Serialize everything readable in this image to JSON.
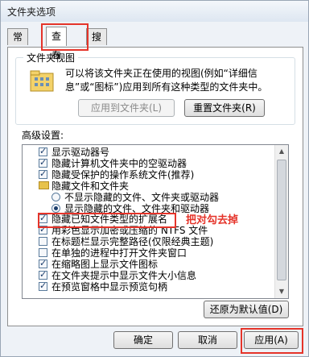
{
  "window": {
    "title": "文件夹选项"
  },
  "tabs": [
    {
      "label": "常规",
      "active": false
    },
    {
      "label": "查看",
      "active": true
    },
    {
      "label": "搜索",
      "active": false
    }
  ],
  "folder_views": {
    "group_label": "文件夹视图",
    "description": "可以将该文件夹正在使用的视图(例如“详细信息”或“图标”)应用到所有这种类型的文件夹中。",
    "apply_button": "应用到文件夹(L)",
    "reset_button": "重置文件夹(R)"
  },
  "advanced": {
    "label": "高级设置:",
    "items": [
      {
        "type": "checkbox",
        "checked": true,
        "indent": 0,
        "label": "显示驱动器号"
      },
      {
        "type": "checkbox",
        "checked": true,
        "indent": 0,
        "label": "隐藏计算机文件夹中的空驱动器"
      },
      {
        "type": "checkbox",
        "checked": true,
        "indent": 0,
        "label": "隐藏受保护的操作系统文件(推荐)"
      },
      {
        "type": "folder",
        "checked": false,
        "indent": 0,
        "label": "隐藏文件和文件夹"
      },
      {
        "type": "radio",
        "checked": false,
        "indent": 1,
        "label": "不显示隐藏的文件、文件夹或驱动器"
      },
      {
        "type": "radio",
        "checked": true,
        "indent": 1,
        "label": "显示隐藏的文件、文件夹和驱动器"
      },
      {
        "type": "checkbox",
        "checked": true,
        "indent": 0,
        "label": "隐藏已知文件类型的扩展名"
      },
      {
        "type": "checkbox",
        "checked": true,
        "indent": 0,
        "label": "用彩色显示加密或压缩的 NTFS 文件"
      },
      {
        "type": "checkbox",
        "checked": false,
        "indent": 0,
        "label": "在标题栏显示完整路径(仅限经典主题)"
      },
      {
        "type": "checkbox",
        "checked": false,
        "indent": 0,
        "label": "在单独的进程中打开文件夹窗口"
      },
      {
        "type": "checkbox",
        "checked": true,
        "indent": 0,
        "label": "在缩略图上显示文件图标"
      },
      {
        "type": "checkbox",
        "checked": true,
        "indent": 0,
        "label": "在文件夹提示中显示文件大小信息"
      },
      {
        "type": "checkbox",
        "checked": true,
        "indent": 0,
        "label": "在预览窗格中显示预览句柄"
      }
    ],
    "annotation": "把对勾去掉",
    "restore_button": "还原为默认值(D)"
  },
  "footer": {
    "ok": "确定",
    "cancel": "取消",
    "apply": "应用(A)"
  },
  "colors": {
    "highlight": "#e5342a",
    "accent": "#1b3d6b"
  }
}
